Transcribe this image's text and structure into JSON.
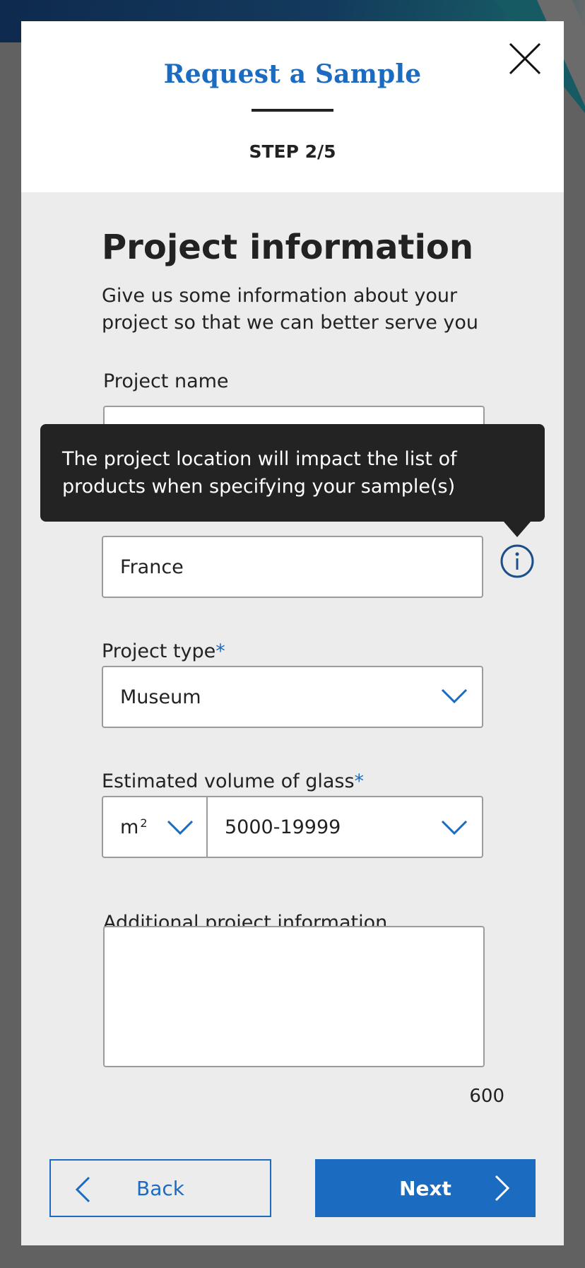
{
  "header": {
    "title": "Request a Sample",
    "step": "STEP 2/5"
  },
  "section": {
    "title": "Project information",
    "subtitle": "Give us some information about your project so that we can better serve you"
  },
  "fields": {
    "project_name": {
      "label": "Project name",
      "value": ""
    },
    "project_location": {
      "value": "France"
    },
    "project_type": {
      "label": "Project type",
      "required_mark": "*",
      "value": "Museum"
    },
    "glass_volume": {
      "label": "Estimated volume of glass",
      "required_mark": "*",
      "unit_base": "m",
      "unit_exponent": "2",
      "value": "5000-19999"
    },
    "additional_info": {
      "label": "Additional project information",
      "value": "",
      "remaining_chars": "600"
    }
  },
  "tooltip": {
    "text": "The project location will impact the list of products when specifying your sample(s)"
  },
  "footer": {
    "back_label": "Back",
    "next_label": "Next"
  },
  "colors": {
    "accent": "#1b6bc0",
    "tooltip_bg": "#232323",
    "panel_bg": "#ececec",
    "overlay": "#616161"
  },
  "icons": [
    "close-icon",
    "info-icon",
    "chevron-down-icon",
    "chevron-left-icon",
    "chevron-right-icon"
  ]
}
